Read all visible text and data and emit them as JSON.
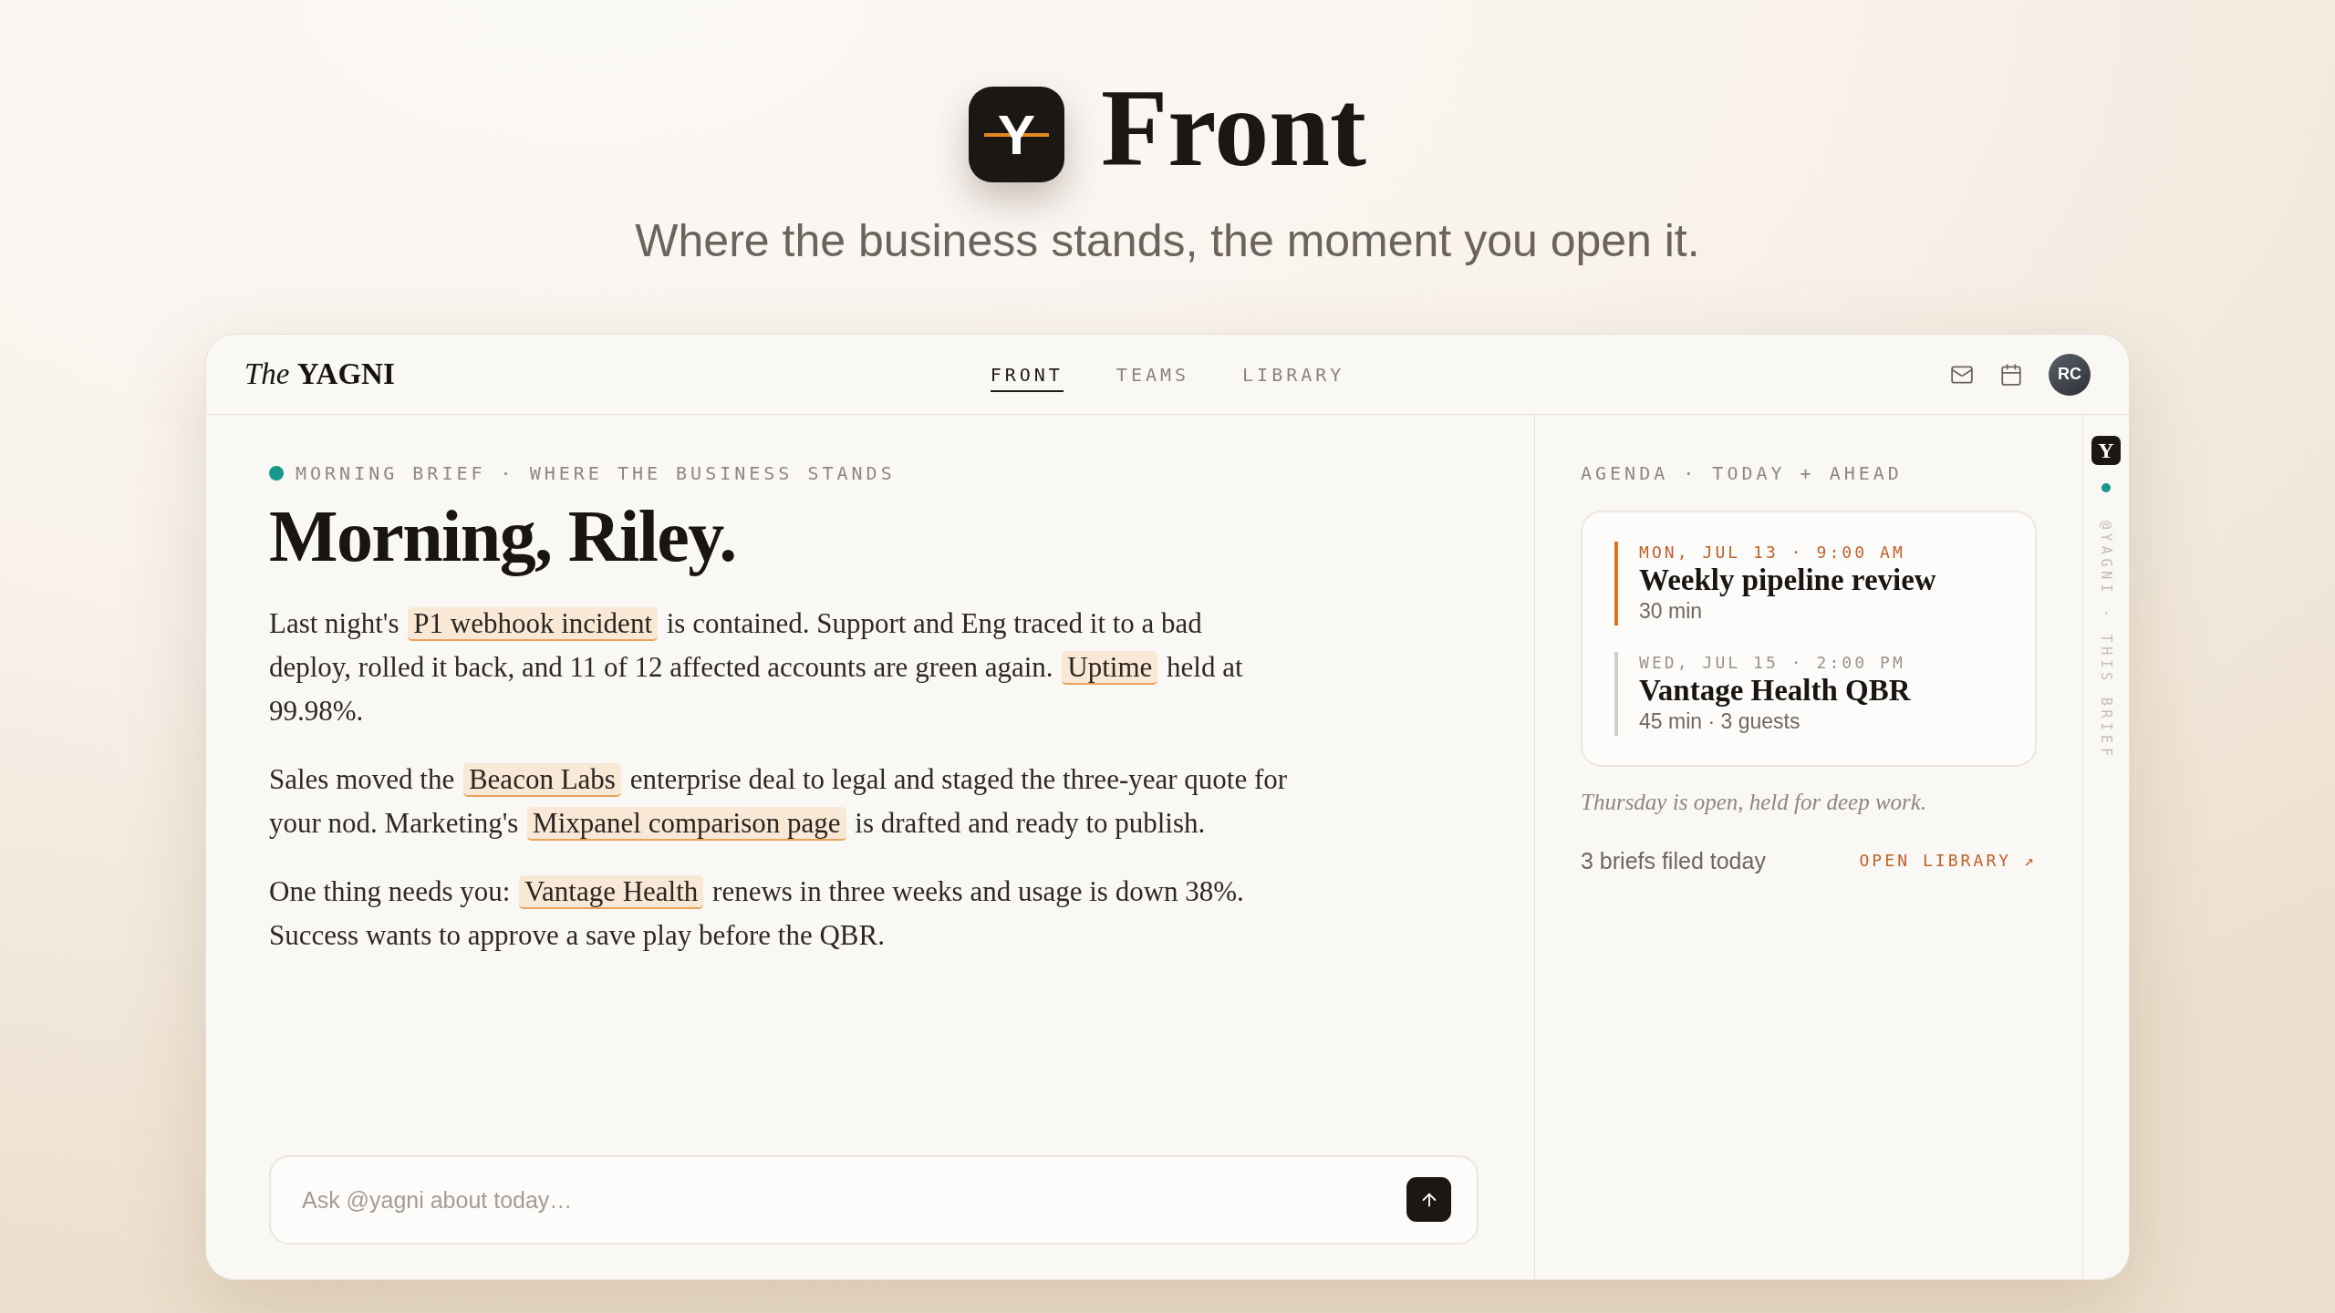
{
  "hero": {
    "logo": "Y",
    "title": "Front",
    "tagline": "Where the business stands, the moment you open it."
  },
  "topbar": {
    "brand": "*The* **YAGNI**",
    "tabs": [
      {
        "label": "FRONT",
        "selected": true
      },
      {
        "label": "TEAMS",
        "selected": false
      },
      {
        "label": "LIBRARY",
        "selected": false
      }
    ],
    "avatar": "RC"
  },
  "brief": {
    "eyebrow": "MORNING BRIEF · WHERE THE BUSINESS STANDS",
    "heading": "Morning, Riley.",
    "paragraphs": [
      [
        {
          "kind": "text",
          "text": "Last night's "
        },
        {
          "kind": "entity",
          "text": "P1 webhook incident"
        },
        {
          "kind": "text",
          "text": " is contained. Support and Eng traced it to a bad deploy, rolled it back, and 11 of 12 affected accounts are green again. "
        },
        {
          "kind": "entity",
          "text": "Uptime"
        },
        {
          "kind": "text",
          "text": " held at 99.98%."
        }
      ],
      [
        {
          "kind": "text",
          "text": "Sales moved the "
        },
        {
          "kind": "entity",
          "text": "Beacon Labs"
        },
        {
          "kind": "text",
          "text": " enterprise deal to legal and staged the three-year quote for your nod. Marketing's "
        },
        {
          "kind": "entity",
          "text": "Mixpanel comparison page"
        },
        {
          "kind": "text",
          "text": " is drafted and ready to publish."
        }
      ],
      [
        {
          "kind": "text",
          "text": "One thing needs you: "
        },
        {
          "kind": "entity",
          "text": "Vantage Health"
        },
        {
          "kind": "text",
          "text": " renews in three weeks and usage is down 38%. Success wants to approve a save play before the QBR."
        }
      ]
    ]
  },
  "composer": {
    "placeholder": "Ask @yagni about today…"
  },
  "agenda": {
    "heading": "AGENDA · TODAY + AHEAD",
    "events": [
      {
        "when": "MON, JUL 13 · 9:00 AM",
        "title": "Weekly pipeline review",
        "detail": "30 min",
        "highlighted": true
      },
      {
        "when": "WED, JUL 15 · 2:00 PM",
        "title": "Vantage Health QBR",
        "detail": "45 min · 3 guests",
        "highlighted": false
      }
    ],
    "note": "Thursday is open, held for deep work.",
    "footer": {
      "count": "3 briefs filed today",
      "link": "OPEN LIBRARY ↗"
    }
  },
  "rail": {
    "logo": "Y",
    "label": "@YAGNI · THIS BRIEF"
  }
}
